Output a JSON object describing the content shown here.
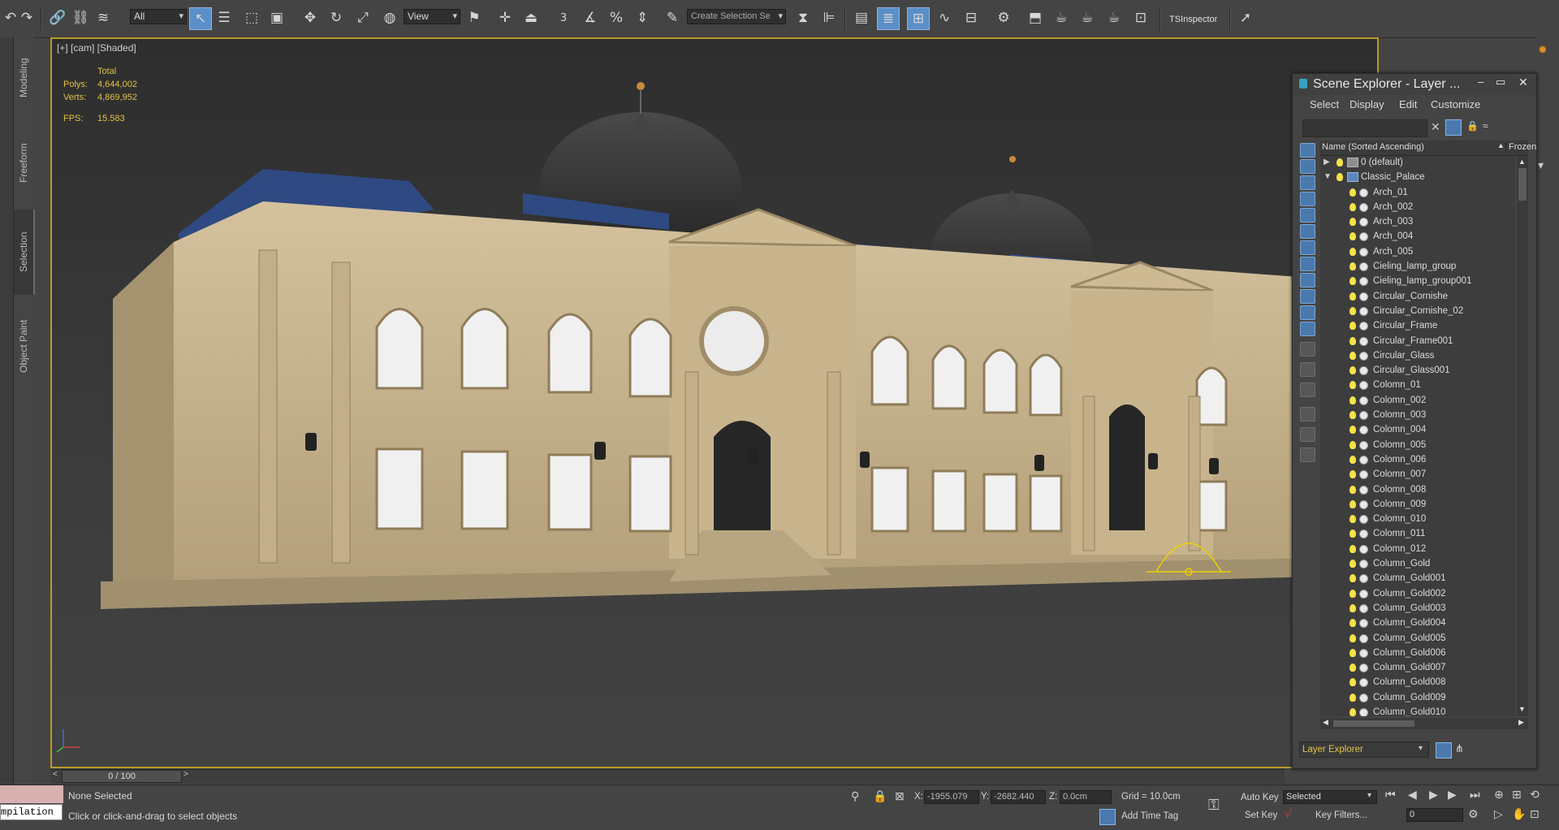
{
  "toolbar": {
    "filter_value": "All",
    "refcoord_value": "View",
    "selection_set_placeholder": "Create Selection Se",
    "snap_number": "3",
    "tsinspector_label": "TSInspector",
    "icons": [
      "undo-icon",
      "redo-icon",
      "link-icon",
      "unlink-icon",
      "bind-space-warp-icon",
      "select-object-icon",
      "select-by-name-icon",
      "rect-region-icon",
      "window-crossing-icon",
      "move-icon",
      "rotate-icon",
      "scale-icon",
      "pivot-icon",
      "named-selection-icon",
      "mirror-icon",
      "align-icon",
      "scene-explorer-icon",
      "layer-explorer-icon",
      "curve-editor-icon",
      "schematic-view-icon",
      "material-editor-icon",
      "render-setup-icon",
      "render-frame-icon",
      "render-icon",
      "render-production-icon",
      "render-iterative-icon"
    ]
  },
  "ribbon_tabs": [
    "Modeling",
    "Freeform",
    "Selection",
    "Object Paint"
  ],
  "ribbon_selected": "Selection",
  "viewport": {
    "label": "[+] [cam] [Shaded]",
    "stats": {
      "total_label": "Total",
      "polys_label": "Polys:",
      "polys_value": "4,644,002",
      "verts_label": "Verts:",
      "verts_value": "4,869,952",
      "fps_label": "FPS:",
      "fps_value": "15.583"
    }
  },
  "scene_explorer": {
    "title": "Scene Explorer - Layer ...",
    "menu": [
      "Select",
      "Display",
      "Edit",
      "Customize"
    ],
    "column_name": "Name (Sorted Ascending)",
    "column_frozen": "Frozen",
    "layers": [
      {
        "label": "0 (default)",
        "type": "layer",
        "expanded": false
      },
      {
        "label": "Classic_Palace",
        "type": "layer",
        "expanded": true
      }
    ],
    "objects": [
      "Arch_01",
      "Arch_002",
      "Arch_003",
      "Arch_004",
      "Arch_005",
      "Cieling_lamp_group",
      "Cieling_lamp_group001",
      "Circular_Cornishe",
      "Circular_Cornishe_02",
      "Circular_Frame",
      "Circular_Frame001",
      "Circular_Glass",
      "Circular_Glass001",
      "Colomn_01",
      "Colomn_002",
      "Colomn_003",
      "Colomn_004",
      "Colomn_005",
      "Colomn_006",
      "Colomn_007",
      "Colomn_008",
      "Colomn_009",
      "Colomn_010",
      "Colomn_011",
      "Colomn_012",
      "Column_Gold",
      "Column_Gold001",
      "Column_Gold002",
      "Column_Gold003",
      "Column_Gold004",
      "Column_Gold005",
      "Column_Gold006",
      "Column_Gold007",
      "Column_Gold008",
      "Column_Gold009",
      "Column_Gold010"
    ],
    "footer": "Layer Explorer"
  },
  "timeline": {
    "frame": "0 / 100"
  },
  "status": {
    "selection": "None Selected",
    "prompt": "Click or click-and-drag to select objects",
    "maxscript": "mpilation :",
    "x_label": "X:",
    "x_value": "-1955.079",
    "y_label": "Y:",
    "y_value": "-2682.440",
    "z_label": "Z:",
    "z_value": "0.0cm",
    "grid": "Grid = 10.0cm",
    "add_time_tag": "Add Time Tag",
    "auto_key": "Auto Key",
    "set_key": "Set Key",
    "key_mode": "Selected",
    "key_filters": "Key Filters...",
    "current_frame": "0"
  },
  "colors": {
    "accent": "#5b8fc7",
    "viewport_border": "#b89a2a",
    "stats_text": "#e3c244"
  }
}
